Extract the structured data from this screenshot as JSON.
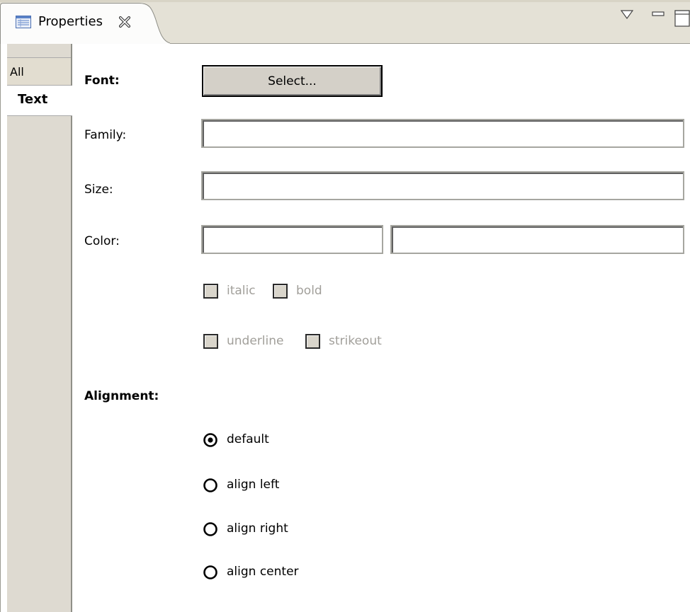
{
  "view": {
    "title": "Properties",
    "icons": {
      "view": "properties-view-icon",
      "close": "close-icon",
      "menu": "view-menu-icon",
      "minimize": "minimize-icon",
      "maximize": "maximize-icon"
    }
  },
  "tabs": [
    {
      "label": "All",
      "selected": false
    },
    {
      "label": "Text",
      "selected": true
    }
  ],
  "form": {
    "font_label": "Font:",
    "select_button": "Select...",
    "family_label": "Family:",
    "family_value": "",
    "size_label": "Size:",
    "size_value": "",
    "color_label": "Color:",
    "color_value_1": "",
    "color_value_2": "",
    "checkboxes": [
      {
        "label": "italic",
        "checked": false,
        "enabled": false
      },
      {
        "label": "bold",
        "checked": false,
        "enabled": false
      },
      {
        "label": "underline",
        "checked": false,
        "enabled": false
      },
      {
        "label": "strikeout",
        "checked": false,
        "enabled": false
      }
    ],
    "alignment_label": "Alignment:",
    "alignment_options": [
      {
        "label": "default",
        "selected": true
      },
      {
        "label": "align left",
        "selected": false
      },
      {
        "label": "align right",
        "selected": false
      },
      {
        "label": "align center",
        "selected": false
      }
    ]
  }
}
